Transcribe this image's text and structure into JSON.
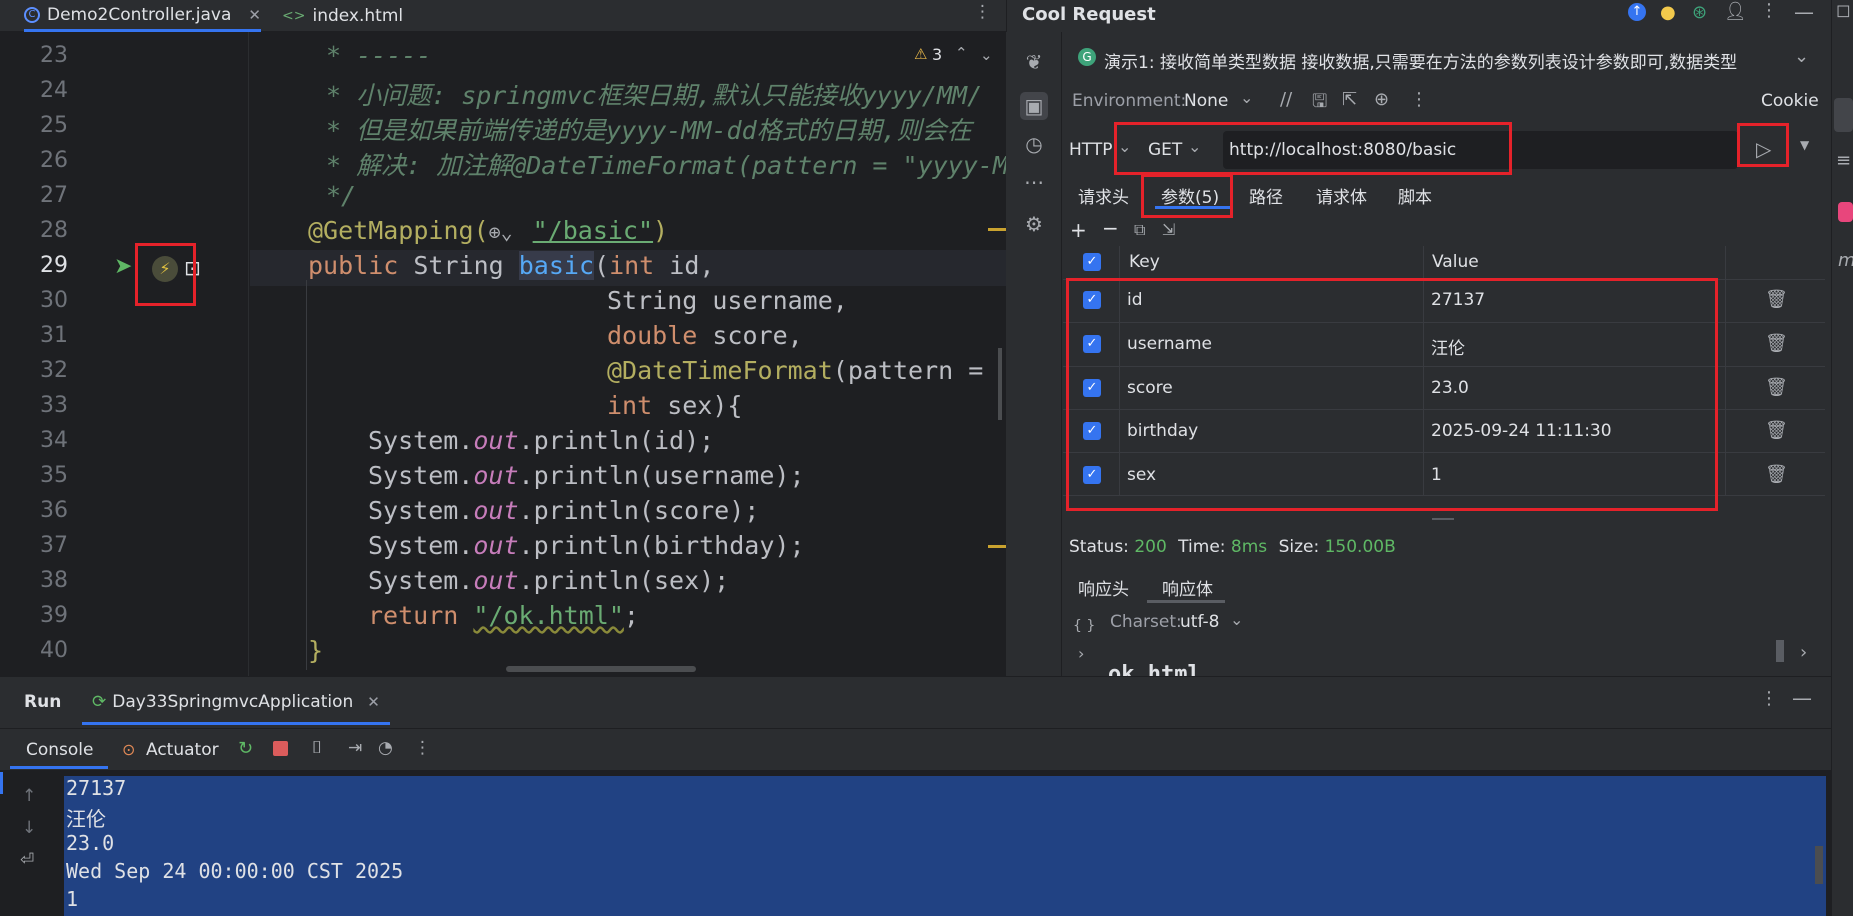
{
  "editor": {
    "tabs": [
      {
        "label": "Demo2Controller.java",
        "icon": "java-class-icon"
      },
      {
        "label": "index.html",
        "icon": "html-icon"
      }
    ],
    "warnings": "3",
    "line_numbers": [
      "23",
      "24",
      "25",
      "26",
      "27",
      "28",
      "29",
      "30",
      "31",
      "32",
      "33",
      "34",
      "35",
      "36",
      "37",
      "38",
      "39",
      "40"
    ],
    "code": {
      "l23": "* -----",
      "l24": "* 小问题: springmvc框架日期,默认只能接收yyyy/MM/",
      "l25": "* 但是如果前端传递的是yyyy-MM-dd格式的日期,则会在",
      "l26": "* 解决: 加注解@DateTimeFormat(pattern = \"yyyy-M",
      "l27": "*/",
      "l28_a": "@GetMapping(",
      "l28_b": "\"/basic\"",
      "l28_c": ")",
      "l29_kw": "public",
      "l29_t": " String ",
      "l29_fn": "basic",
      "l29_p": "(",
      "l29_kw2": "int",
      "l29_r": " id,",
      "l30": "String username,",
      "l31_kw": "double",
      "l31_r": " score,",
      "l32_an": "@DateTimeFormat",
      "l32_r": "(pattern = ",
      "l33_kw": "int",
      "l33_r": " sex){",
      "l34_a": "System.",
      "l34_f": "out",
      "l34_b": ".println(id);",
      "l35_b": ".println(username);",
      "l36_b": ".println(score);",
      "l37_b": ".println(birthday);",
      "l38_b": ".println(sex);",
      "l39_kw": "return",
      "l39_s": "\"/ok.html\"",
      "l39_r": ";",
      "l40": "}"
    }
  },
  "cool_request": {
    "title": "Cool Request",
    "api_label": "演示1: 接收简单类型数据 接收数据,只需要在方法的参数列表设计参数即可,数据类型",
    "environment_label": "Environment:",
    "environment_value": "None",
    "cookie_label": "Cookie",
    "protocol": "HTTP",
    "method": "GET",
    "url": "http://localhost:8080/basic",
    "tabs": [
      "请求头",
      "参数(5)",
      "路径",
      "请求体",
      "脚本"
    ],
    "table_headers": {
      "key": "Key",
      "value": "Value"
    },
    "params": [
      {
        "key": "id",
        "value": "27137"
      },
      {
        "key": "username",
        "value": "汪伦"
      },
      {
        "key": "score",
        "value": "23.0"
      },
      {
        "key": "birthday",
        "value": "2025-09-24 11:11:30"
      },
      {
        "key": "sex",
        "value": "1"
      }
    ],
    "status_label": "Status:",
    "status_value": "200",
    "time_label": "Time:",
    "time_value": "8ms",
    "size_label": "Size:",
    "size_value": "150.00B",
    "response_tabs": [
      "响应头",
      "响应体"
    ],
    "charset_label": "Charset:",
    "charset_value": "utf-8",
    "response_preview": "ok.html"
  },
  "run": {
    "title": "Run",
    "config": "Day33SpringmvcApplication",
    "tabs": [
      "Console",
      "Actuator"
    ],
    "output": [
      "27137",
      "汪伦",
      "23.0",
      "Wed Sep 24 00:00:00 CST 2025",
      "1"
    ]
  },
  "colors": {
    "accent": "#3574f0",
    "highlight_box": "#e5222a",
    "status_ok": "#5fb865",
    "selection": "#214283"
  }
}
